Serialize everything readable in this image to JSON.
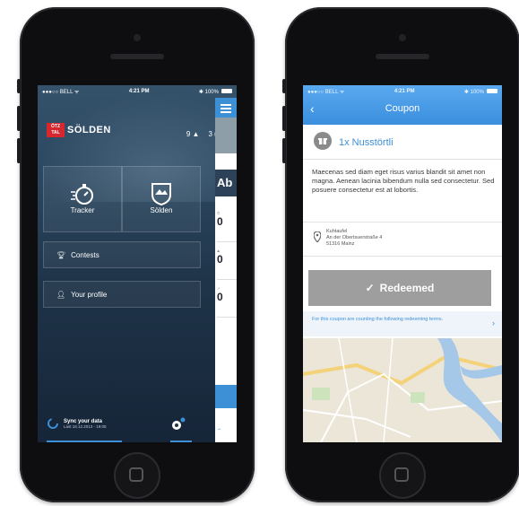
{
  "left_phone": {
    "status": {
      "carrier": "BELL",
      "time": "4:21 PM",
      "battery": "100%"
    },
    "logo": {
      "badge_line1": "ÖTZ",
      "badge_line2": "TAL",
      "name": "SÖLDEN"
    },
    "counts": {
      "a": "9",
      "b": "3"
    },
    "tiles": [
      {
        "label": "Tracker"
      },
      {
        "label": "Sölden"
      }
    ],
    "rows": [
      {
        "label": "Contests"
      },
      {
        "label": "Your profile"
      }
    ],
    "sync": {
      "title": "Sync your data",
      "subtitle": "Last 18.12.2013 - 19:05"
    },
    "side_panel": {
      "heading": "Ab",
      "values": [
        "0",
        "0",
        "0"
      ]
    }
  },
  "right_phone": {
    "status": {
      "carrier": "BELL",
      "time": "4:21 PM",
      "battery": "100%"
    },
    "header_title": "Coupon",
    "coupon_name": "1x Nusstörtli",
    "description": "Maecenas sed diam eget risus varius blandit sit amet non magna. Aenean lacinia bibendum nulla sed consectetur. Sed posuere consectetur est at lobortis.",
    "address": {
      "line1": "Kuhtaufel",
      "line2": "An der Obertsuerstraße 4",
      "line3": "51316 Mainz"
    },
    "redeem_label": "Redeemed",
    "terms_text": "For this coupon are counting the following redeeming terms."
  },
  "colors": {
    "accent": "#3d8fd6",
    "brand_red": "#d8262e",
    "redeemed_gray": "#9e9e9e"
  }
}
